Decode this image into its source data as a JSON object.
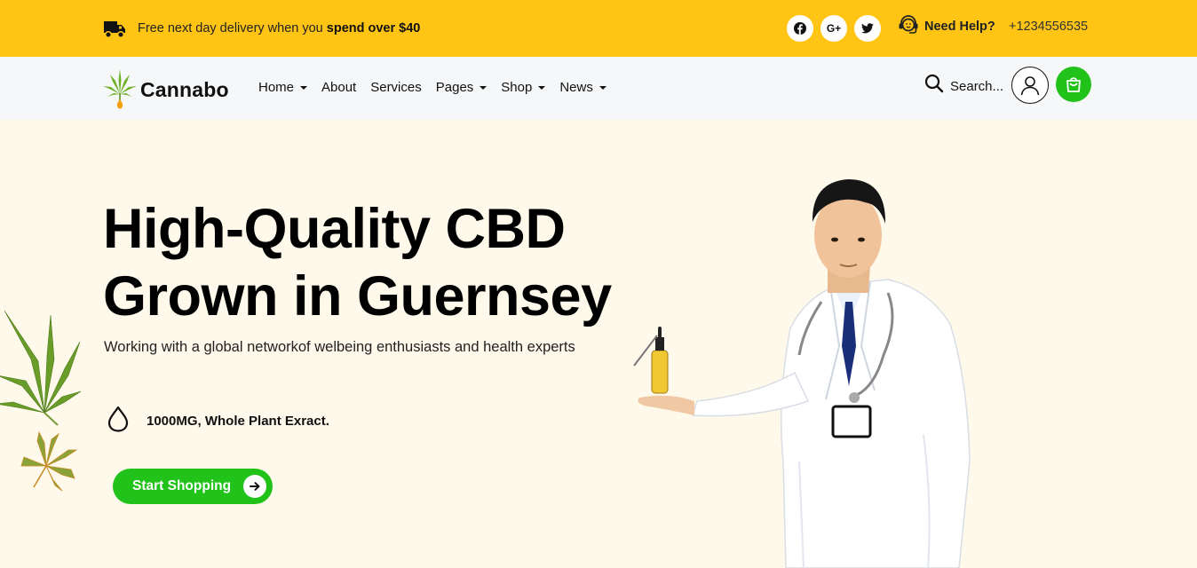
{
  "topbar": {
    "delivery_prefix": "Free next day delivery when you ",
    "delivery_bold": "spend over $40",
    "social": [
      "facebook-icon",
      "google-plus-icon",
      "twitter-icon"
    ],
    "google_plus_glyph": "G+",
    "need_help": "Need Help?",
    "phone": "+1234556535",
    "bg_color": "#ffc414"
  },
  "brand": {
    "name": "Cannabo"
  },
  "nav": {
    "items": [
      {
        "label": "Home",
        "dropdown": true
      },
      {
        "label": "About",
        "dropdown": false
      },
      {
        "label": "Services",
        "dropdown": false
      },
      {
        "label": "Pages",
        "dropdown": true
      },
      {
        "label": "Shop",
        "dropdown": true
      },
      {
        "label": "News",
        "dropdown": true
      }
    ],
    "search_label": "Search...",
    "accent_color": "#21c21a"
  },
  "hero": {
    "title_line1": "High-Quality CBD",
    "title_line2": "Grown in Guernsey",
    "subtitle": "Working with a global networkof welbeing enthusiasts and health experts",
    "feature": "1000MG, Whole Plant Exract.",
    "cta_label": "Start Shopping",
    "bg_color": "#fef9ea"
  }
}
